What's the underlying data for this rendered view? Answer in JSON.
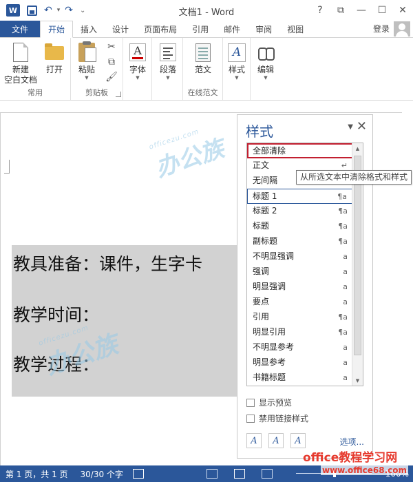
{
  "window": {
    "title": "文档1 - Word",
    "word_logo": "W",
    "help": "?",
    "restore": "⧉",
    "minimize": "—",
    "maximize": "☐",
    "close": "✕"
  },
  "quick_access": {
    "undo": "↶",
    "redo": "↷",
    "customize": "⌄"
  },
  "tabs": [
    {
      "label": "文件"
    },
    {
      "label": "开始"
    },
    {
      "label": "插入"
    },
    {
      "label": "设计"
    },
    {
      "label": "页面布局"
    },
    {
      "label": "引用"
    },
    {
      "label": "邮件"
    },
    {
      "label": "审阅"
    },
    {
      "label": "视图"
    }
  ],
  "account": {
    "signin": "登录"
  },
  "ribbon": {
    "groups": {
      "common": "常用",
      "clipboard": "剪贴板",
      "online_templates": "在线范文"
    },
    "buttons": {
      "new_blank_line1": "新建",
      "new_blank_line2": "空白文档",
      "open": "打开",
      "paste": "粘贴",
      "font": "字体",
      "paragraph": "段落",
      "template": "范文",
      "styles": "样式",
      "editing": "编辑"
    }
  },
  "document": {
    "lines": [
      "教具准备：课件，生字卡",
      "教学时间：",
      "教学过程："
    ],
    "watermark_text": "办公族",
    "watermark_sub": "officezu.com"
  },
  "styles_pane": {
    "title": "样式",
    "options_glyph": "▼",
    "close_glyph": "✕",
    "items": [
      {
        "label": "全部清除",
        "mark": ""
      },
      {
        "label": "正文",
        "mark": "↵"
      },
      {
        "label": "无间隔",
        "mark": "↵"
      },
      {
        "label": "标题 1",
        "mark": "¶a"
      },
      {
        "label": "标题 2",
        "mark": "¶a"
      },
      {
        "label": "标题",
        "mark": "¶a"
      },
      {
        "label": "副标题",
        "mark": "¶a"
      },
      {
        "label": "不明显强调",
        "mark": "a"
      },
      {
        "label": "强调",
        "mark": "a"
      },
      {
        "label": "明显强调",
        "mark": "a"
      },
      {
        "label": "要点",
        "mark": "a"
      },
      {
        "label": "引用",
        "mark": "¶a"
      },
      {
        "label": "明显引用",
        "mark": "¶a"
      },
      {
        "label": "不明显参考",
        "mark": "a"
      },
      {
        "label": "明显参考",
        "mark": "a"
      },
      {
        "label": "书籍标题",
        "mark": "a"
      }
    ],
    "show_preview": "显示预览",
    "disable_linked": "禁用链接样式",
    "options_link": "选项...",
    "btn_new": "A",
    "btn_inspect": "A",
    "btn_manage": "A"
  },
  "tooltip": "从所选文本中清除格式和样式",
  "status": {
    "page": "第 1 页，共 1 页",
    "words": "30/30 个字",
    "zoom": "100%"
  },
  "site_watermark": {
    "brand": "office教程学习网",
    "url": "www.office68.com"
  },
  "colors": {
    "accent": "#2b579a",
    "clear_border": "#c21f30",
    "selection": "#d2d2d2",
    "watermark_red": "#e63a2e"
  }
}
